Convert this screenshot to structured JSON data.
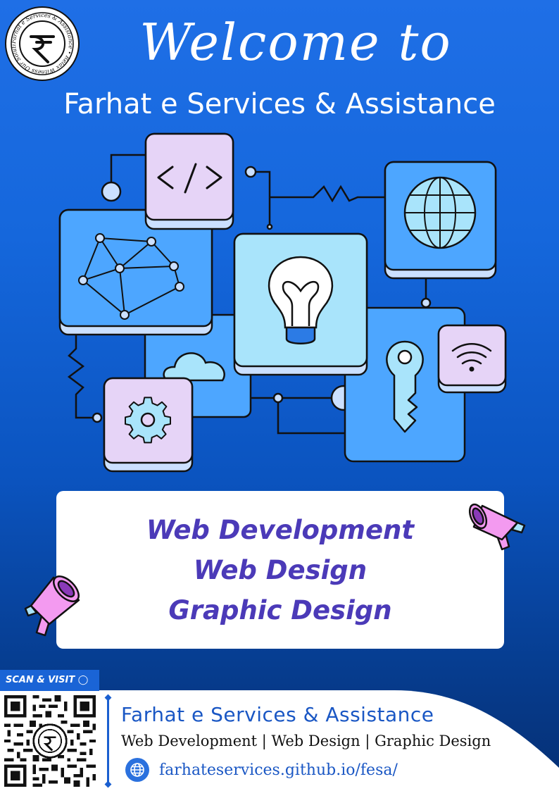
{
  "header": {
    "welcome": "Welcome to",
    "brand_name": "Farhat e Services & Assistance"
  },
  "logo": {
    "icon": "rupee-seal-icon",
    "ring_text": "Farhat e Services & Assistance • Relax Witness Our Solutions"
  },
  "services": {
    "items": [
      "Web Development",
      "Web Design",
      "Graphic Design"
    ]
  },
  "footer": {
    "qr_label": "SCAN & VISIT",
    "brand_name": "Farhat e Services & Assistance",
    "services_line": "Web Development | Web Design | Graphic Design",
    "url": "farhateservices.github.io/fesa/"
  },
  "colors": {
    "background_top": "#1f6fe6",
    "background_bottom": "#052f73",
    "service_text": "#4b3ab8",
    "tile_lavender": "#e6d4f7",
    "tile_blue": "#4da6ff",
    "tile_light": "#a9e4fb",
    "megaphone": "#f39af0"
  }
}
